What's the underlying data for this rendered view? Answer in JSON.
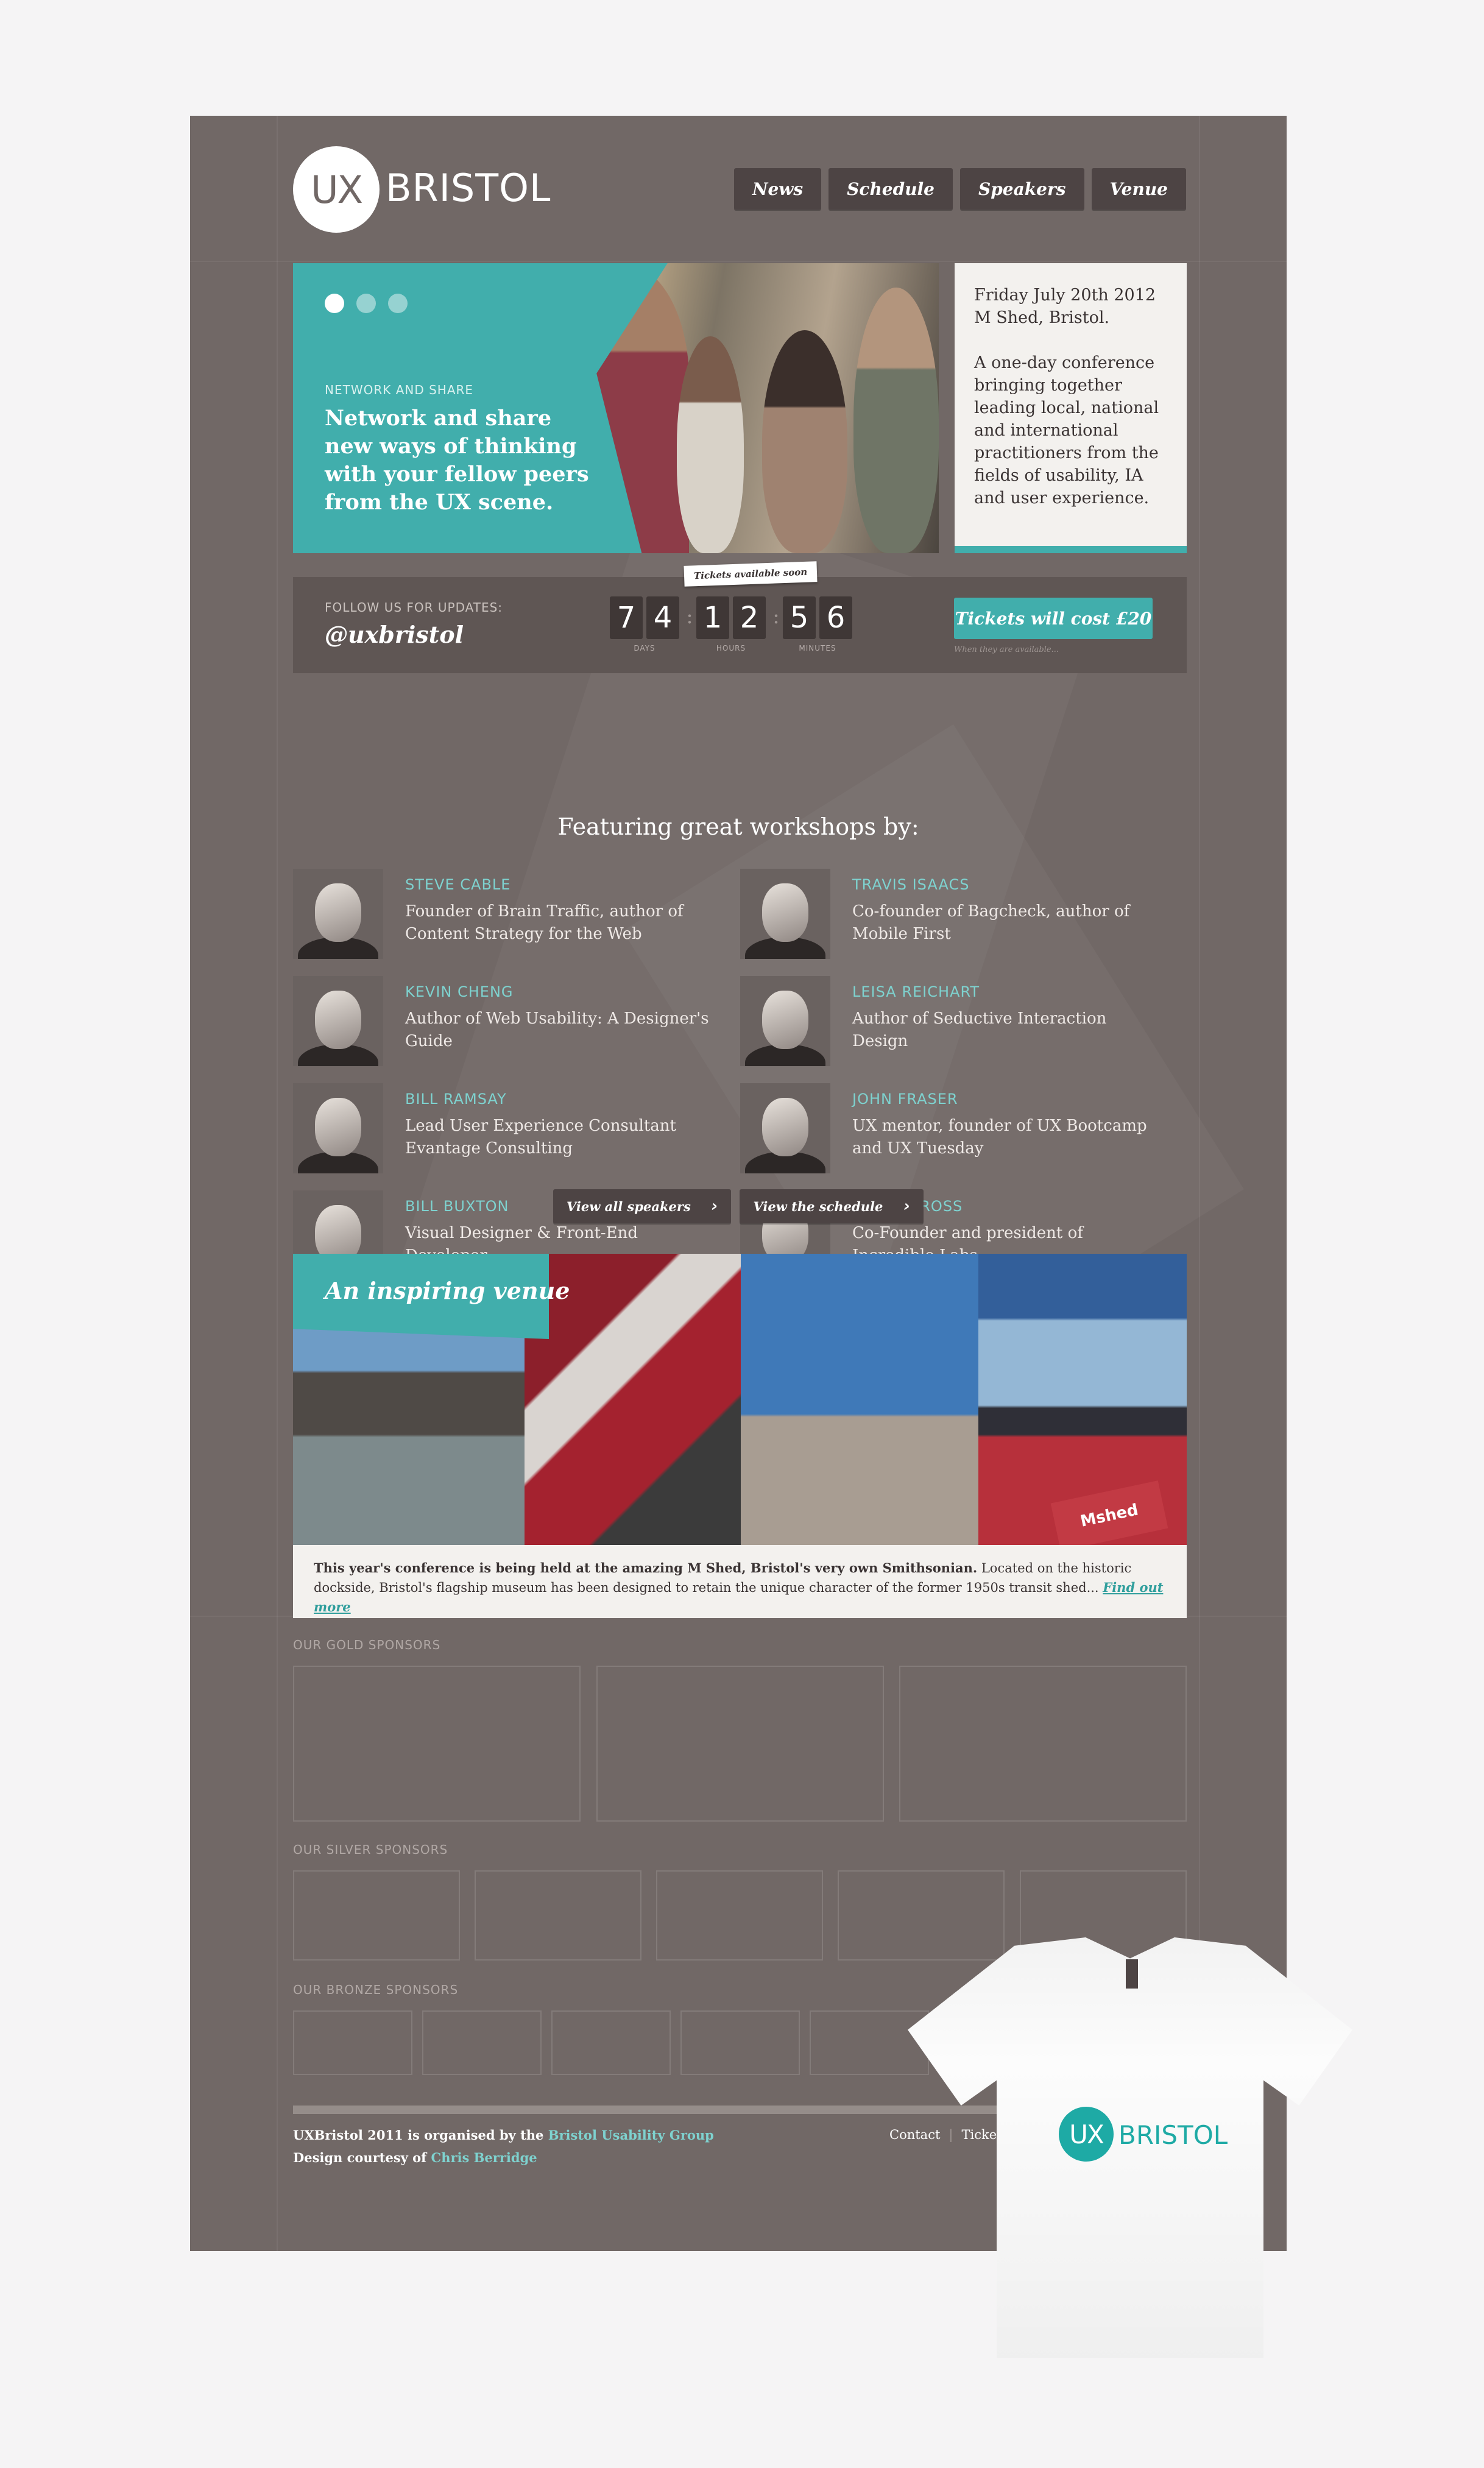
{
  "header": {
    "logo_mark": "UX",
    "logo_word": "BRISTOL",
    "nav": [
      "News",
      "Schedule",
      "Speakers",
      "Venue"
    ]
  },
  "hero": {
    "kicker": "NETWORK AND SHARE",
    "headline": "Network and share new ways of thinking with your fellow peers from the UX scene.",
    "slide_count": 3,
    "active_slide": 1
  },
  "intro": {
    "date_line": "Friday July 20th 2012",
    "place_line": "M Shed, Bristol.",
    "description": "A one-day conference bringing together leading local, national and international practitioners from the fields of usability, IA and user experience."
  },
  "follow": {
    "label": "FOLLOW US FOR UPDATES:",
    "handle": "@uxbristol"
  },
  "countdown": {
    "tag": "Tickets available soon",
    "days": [
      "7",
      "4"
    ],
    "hours": [
      "1",
      "2"
    ],
    "minutes": [
      "5",
      "6"
    ],
    "separator": ":",
    "days_label": "DAYS",
    "hours_label": "HOURS",
    "minutes_label": "MINUTES"
  },
  "tickets": {
    "button": "Tickets will cost £20",
    "note": "When they are available..."
  },
  "workshops": {
    "title": "Featuring great workshops by:",
    "speakers": [
      {
        "name": "STEVE CABLE",
        "bio": "Founder of Brain Traffic, author of Content Strategy for the Web"
      },
      {
        "name": "TRAVIS ISAACS",
        "bio": "Co-founder of Bagcheck, author of Mobile First"
      },
      {
        "name": "KEVIN CHENG",
        "bio": "Author of Web Usability: A Designer's Guide"
      },
      {
        "name": "LEISA REICHART",
        "bio": "Author of Seductive Interaction Design"
      },
      {
        "name": "BILL RAMSAY",
        "bio": "Lead User Experience Consultant Evantage Consulting"
      },
      {
        "name": "JOHN FRASER",
        "bio": "UX mentor, founder of UX Bootcamp and UX Tuesday"
      },
      {
        "name": "BILL BUXTON",
        "bio": "Visual Designer & Front-End Developer"
      },
      {
        "name": "SIMON CROSS",
        "bio": "Co-Founder and president of Incredible Labs"
      }
    ],
    "view_speakers": "View all speakers",
    "view_schedule": "View the schedule"
  },
  "venue": {
    "title": "An inspiring venue",
    "sign": "Mshed",
    "text_bold": "This year's conference is being held at the amazing M Shed, Bristol's very own Smithsonian.",
    "text_rest": " Located on the historic dockside, Bristol's flagship museum has been designed to retain the unique character of the former 1950s transit shed...",
    "link": "Find out more"
  },
  "sponsors": {
    "gold_label": "OUR GOLD SPONSORS",
    "silver_label": "OUR SILVER SPONSORS",
    "bronze_label": "OUR BRONZE SPONSORS"
  },
  "footer": {
    "line1_prefix": "UXBristol 2011 is organised by the ",
    "line1_link": "Bristol Usability Group",
    "line2_prefix": "Design courtesy of ",
    "line2_link": "Chris Berridge",
    "contact": "Contact",
    "tickets": "Tickets"
  },
  "tshirt": {
    "logo_mark": "UX",
    "logo_word": "BRISTOL"
  },
  "colors": {
    "page_bg": "#716866",
    "accent_teal": "#41aeac",
    "dark_button": "#4d4444",
    "link_teal": "#7ed2cf",
    "outer_bg": "#f5f4f5"
  }
}
